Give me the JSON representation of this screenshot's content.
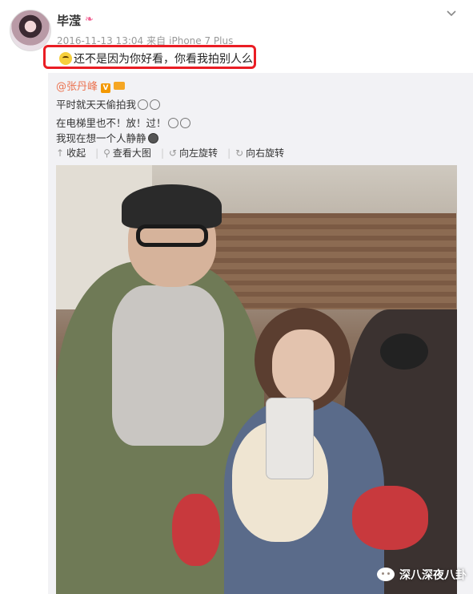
{
  "post": {
    "username": "毕滢",
    "timestamp": "2016-11-13 13:04",
    "source_prefix": "来自",
    "device": "iPhone 7 Plus",
    "text": "还不是因为你好看，你看我拍别人么"
  },
  "repost": {
    "author": "@张丹峰",
    "lines": [
      "平时就天天偷拍我",
      "在电梯里也不！放！过！",
      "我现在想一个人静静"
    ]
  },
  "actions": {
    "collapse": "收起",
    "view_large": "查看大图",
    "rotate_left": "向左旋转",
    "rotate_right": "向右旋转"
  },
  "watermark": {
    "text": "深八深夜八卦"
  },
  "colors": {
    "highlight_border": "#ea1d24",
    "mention": "#eb7350",
    "meta": "#999999"
  }
}
